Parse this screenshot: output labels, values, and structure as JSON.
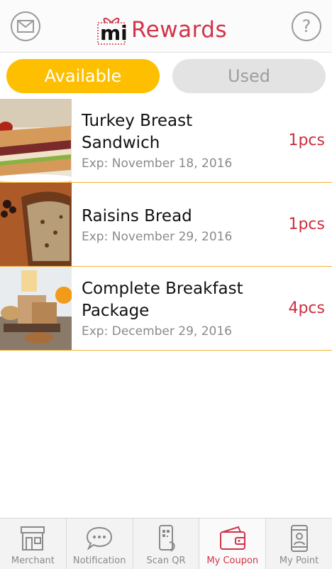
{
  "header": {
    "brand_prefix": "mi",
    "brand_name": "Rewards",
    "left_icon": "mail-icon",
    "right_icon": "help-icon"
  },
  "tabs": [
    {
      "label": "Available",
      "active": true
    },
    {
      "label": "Used",
      "active": false
    }
  ],
  "coupons": [
    {
      "title": "Turkey Breast Sandwich",
      "expiry": "Exp: November 18, 2016",
      "quantity": "1pcs",
      "image": "sandwich-photo"
    },
    {
      "title": "Raisins Bread",
      "expiry": "Exp: November 29, 2016",
      "quantity": "1pcs",
      "image": "raisin-bread-photo"
    },
    {
      "title": "Complete Breakfast Package",
      "expiry": "Exp: December 29, 2016",
      "quantity": "4pcs",
      "image": "breakfast-photo"
    }
  ],
  "bottom_nav": [
    {
      "label": "Merchant",
      "icon": "storefront-icon",
      "active": false
    },
    {
      "label": "Notification",
      "icon": "chat-bubble-icon",
      "active": false
    },
    {
      "label": "Scan QR",
      "icon": "phone-qr-icon",
      "active": false
    },
    {
      "label": "My Coupon",
      "icon": "wallet-icon",
      "active": true
    },
    {
      "label": "My Point",
      "icon": "phone-user-icon",
      "active": false
    }
  ],
  "colors": {
    "brand": "#d0344a",
    "accent": "#fdbf00",
    "divider": "#f3b233",
    "quantity": "#cc2e3f"
  }
}
